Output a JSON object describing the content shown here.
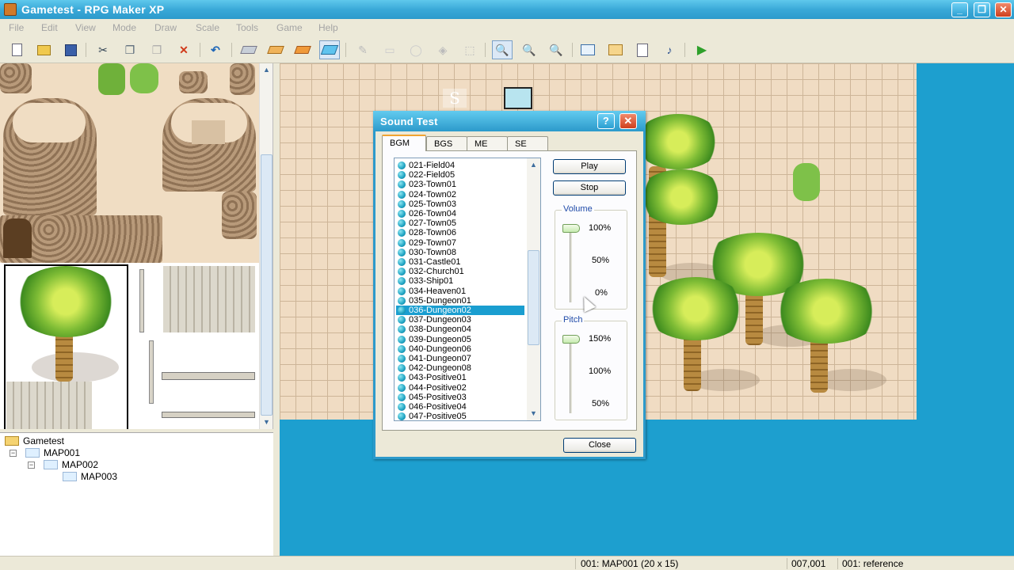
{
  "window": {
    "title": "Gametest - RPG Maker XP"
  },
  "menu": [
    "File",
    "Edit",
    "View",
    "Mode",
    "Draw",
    "Scale",
    "Tools",
    "Game",
    "Help"
  ],
  "toolbar": {
    "icons": [
      "new-project-icon",
      "open-project-icon",
      "save-icon",
      "cut-icon",
      "copy-icon",
      "paste-icon",
      "delete-icon",
      "undo-icon",
      "layer1-icon",
      "layer2-icon",
      "layer3-icon",
      "events-layer-icon",
      "pencil-icon",
      "rectangle-icon",
      "ellipse-icon",
      "fill-icon",
      "select-icon",
      "zoom-1-icon",
      "zoom-2-icon",
      "zoom-4-icon",
      "database-icon",
      "materialbase-icon",
      "script-editor-icon",
      "sound-test-icon",
      "playtest-icon"
    ]
  },
  "map_tree": {
    "root": "Gametest",
    "items": [
      {
        "label": "MAP001"
      },
      {
        "label": "MAP002"
      },
      {
        "label": "MAP003"
      }
    ]
  },
  "map": {
    "start_marker": "S"
  },
  "dialog": {
    "title": "Sound Test",
    "help_symbol": "?",
    "close_symbol": "✕",
    "tabs": [
      "BGM",
      "BGS",
      "ME",
      "SE"
    ],
    "active_tab": "BGM",
    "tracks": [
      "021-Field04",
      "022-Field05",
      "023-Town01",
      "024-Town02",
      "025-Town03",
      "026-Town04",
      "027-Town05",
      "028-Town06",
      "029-Town07",
      "030-Town08",
      "031-Castle01",
      "032-Church01",
      "033-Ship01",
      "034-Heaven01",
      "035-Dungeon01",
      "036-Dungeon02",
      "037-Dungeon03",
      "038-Dungeon04",
      "039-Dungeon05",
      "040-Dungeon06",
      "041-Dungeon07",
      "042-Dungeon08",
      "043-Positive01",
      "044-Positive02",
      "045-Positive03",
      "046-Positive04",
      "047-Positive05"
    ],
    "selected_track": "036-Dungeon02",
    "play_label": "Play",
    "stop_label": "Stop",
    "close_label": "Close",
    "volume": {
      "label": "Volume",
      "ticks": [
        "100%",
        "50%",
        "0%"
      ],
      "value": "100%"
    },
    "pitch": {
      "label": "Pitch",
      "ticks": [
        "150%",
        "100%",
        "50%"
      ],
      "value": "150%"
    }
  },
  "status": {
    "map_info": "001: MAP001 (20 x 15)",
    "coords": "007,001",
    "event_info": "001: reference"
  },
  "colors": {
    "title_bar": "#2c9acb",
    "water": "#1d9fcf",
    "selection": "#1a9ed0"
  }
}
